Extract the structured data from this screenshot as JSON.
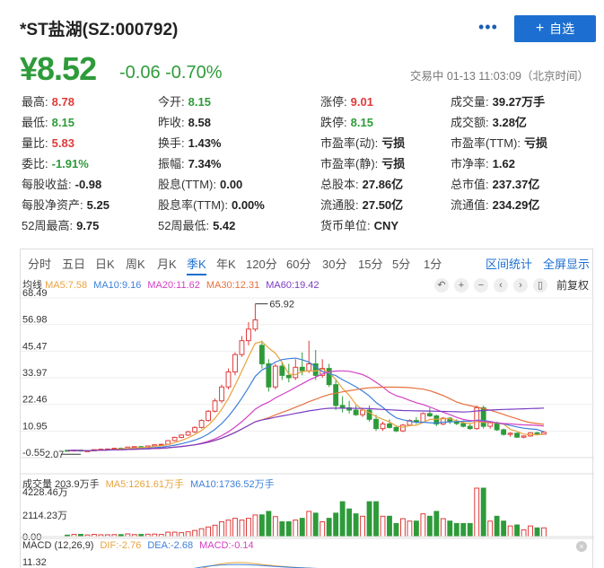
{
  "header": {
    "title": "*ST盐湖(SZ:000792)",
    "more": "•••",
    "add_label": "自选",
    "price": "¥8.52",
    "change": "-0.06 -0.70%",
    "status": "交易中 01-13 11:03:09（北京时间）"
  },
  "stats": [
    [
      {
        "label": "最高:",
        "value": "8.78",
        "tone": "up"
      },
      {
        "label": "今开:",
        "value": "8.15",
        "tone": "down"
      },
      {
        "label": "涨停:",
        "value": "9.01",
        "tone": "up"
      },
      {
        "label": "成交量:",
        "value": "39.27万手",
        "tone": ""
      }
    ],
    [
      {
        "label": "最低:",
        "value": "8.15",
        "tone": "down"
      },
      {
        "label": "昨收:",
        "value": "8.58",
        "tone": ""
      },
      {
        "label": "跌停:",
        "value": "8.15",
        "tone": "down"
      },
      {
        "label": "成交额:",
        "value": "3.28亿",
        "tone": ""
      }
    ],
    [
      {
        "label": "量比:",
        "value": "5.83",
        "tone": "up"
      },
      {
        "label": "换手:",
        "value": "1.43%",
        "tone": ""
      },
      {
        "label": "市盈率(动):",
        "value": "亏损",
        "tone": ""
      },
      {
        "label": "市盈率(TTM):",
        "value": "亏损",
        "tone": ""
      }
    ],
    [
      {
        "label": "委比:",
        "value": "-1.91%",
        "tone": "down"
      },
      {
        "label": "振幅:",
        "value": "7.34%",
        "tone": ""
      },
      {
        "label": "市盈率(静):",
        "value": "亏损",
        "tone": ""
      },
      {
        "label": "市净率:",
        "value": "1.62",
        "tone": ""
      }
    ],
    [
      {
        "label": "每股收益:",
        "value": "-0.98",
        "tone": ""
      },
      {
        "label": "股息(TTM):",
        "value": "0.00",
        "tone": ""
      },
      {
        "label": "总股本:",
        "value": "27.86亿",
        "tone": ""
      },
      {
        "label": "总市值:",
        "value": "237.37亿",
        "tone": ""
      }
    ],
    [
      {
        "label": "每股净资产:",
        "value": "5.25",
        "tone": ""
      },
      {
        "label": "股息率(TTM):",
        "value": "0.00%",
        "tone": ""
      },
      {
        "label": "流通股:",
        "value": "27.50亿",
        "tone": ""
      },
      {
        "label": "流通值:",
        "value": "234.29亿",
        "tone": ""
      }
    ],
    [
      {
        "label": "52周最高:",
        "value": "9.75",
        "tone": ""
      },
      {
        "label": "52周最低:",
        "value": "5.42",
        "tone": ""
      },
      {
        "label": "货币单位:",
        "value": "CNY",
        "tone": ""
      },
      {
        "label": "",
        "value": "",
        "tone": ""
      }
    ]
  ],
  "tabs": [
    "分时",
    "五日",
    "日K",
    "周K",
    "月K",
    "季K",
    "年K",
    "120分",
    "60分",
    "30分",
    "15分",
    "5分",
    "1分"
  ],
  "active_tab": "季K",
  "tab_actions": {
    "interval": "区间统计",
    "fullscreen": "全屏显示"
  },
  "ma_legend": {
    "label": "均线",
    "items": [
      {
        "text": "MA5:7.58",
        "color": "#e8a33d"
      },
      {
        "text": "MA10:9.16",
        "color": "#3d7fd9"
      },
      {
        "text": "MA20:11.62",
        "color": "#d43fc4"
      },
      {
        "text": "MA30:12.31",
        "color": "#e8703d"
      },
      {
        "text": "MA60:19.42",
        "color": "#7a3dc4"
      }
    ]
  },
  "restore_label": "前复权",
  "price_axis": [
    "68.49",
    "56.98",
    "45.47",
    "33.97",
    "22.46",
    "10.95",
    "-0.55"
  ],
  "annotations": {
    "high": "65.92",
    "low": "2.07"
  },
  "vol_legend": {
    "items": [
      {
        "text": "成交量 203.9万手",
        "color": "#333"
      },
      {
        "text": "MA5:1261.61万手",
        "color": "#e8a33d"
      },
      {
        "text": "MA10:1736.52万手",
        "color": "#3d7fd9"
      }
    ]
  },
  "vol_axis": [
    "4228.46万",
    "2114.23万",
    "0.00"
  ],
  "macd_legend": {
    "items": [
      {
        "text": "MACD (12,26,9)",
        "color": "#333"
      },
      {
        "text": "DIF:-2.76",
        "color": "#e8a33d"
      },
      {
        "text": "DEA:-2.68",
        "color": "#3d7fd9"
      },
      {
        "text": "MACD:-0.14",
        "color": "#d43fc4"
      }
    ]
  },
  "macd_axis": [
    "11.32"
  ],
  "colors": {
    "up": "#e03b3b",
    "down": "#2e9b3a",
    "accent": "#1c6fd0"
  },
  "chart_data": {
    "type": "candlestick",
    "ylim": [
      -0.55,
      68.49
    ],
    "candles": [
      [
        2.6,
        2.7,
        2.4,
        2.5
      ],
      [
        2.5,
        2.9,
        2.2,
        2.7
      ],
      [
        2.7,
        2.8,
        2.07,
        2.3
      ],
      [
        2.3,
        2.6,
        2.2,
        2.4
      ],
      [
        2.4,
        3.0,
        2.3,
        2.9
      ],
      [
        2.9,
        3.3,
        2.8,
        3.1
      ],
      [
        3.1,
        3.4,
        2.9,
        3.2
      ],
      [
        3.2,
        3.6,
        3.0,
        3.5
      ],
      [
        3.5,
        3.8,
        3.2,
        3.3
      ],
      [
        3.3,
        4.2,
        3.2,
        4.0
      ],
      [
        4.0,
        4.3,
        3.7,
        4.2
      ],
      [
        4.2,
        4.5,
        3.8,
        3.9
      ],
      [
        3.9,
        4.6,
        3.8,
        4.5
      ],
      [
        4.5,
        5.2,
        4.3,
        5.0
      ],
      [
        5.0,
        5.4,
        4.7,
        5.2
      ],
      [
        5.2,
        7.0,
        5.0,
        6.8
      ],
      [
        6.8,
        8.5,
        6.5,
        8.2
      ],
      [
        8.2,
        9.5,
        7.8,
        9.2
      ],
      [
        9.2,
        11.0,
        8.8,
        10.6
      ],
      [
        10.6,
        13.0,
        10.0,
        12.5
      ],
      [
        12.5,
        16.0,
        12.0,
        15.5
      ],
      [
        15.5,
        20.0,
        15.0,
        19.5
      ],
      [
        19.5,
        25.0,
        19.0,
        24.0
      ],
      [
        24.0,
        31.0,
        23.0,
        30.0
      ],
      [
        30.0,
        38.0,
        29.0,
        36.5
      ],
      [
        36.5,
        45.0,
        35.0,
        44.0
      ],
      [
        44.0,
        52.0,
        43.0,
        50.0
      ],
      [
        50.0,
        58.0,
        48.0,
        55.0
      ],
      [
        55.0,
        65.92,
        54.0,
        59.0
      ],
      [
        48.0,
        50.0,
        38.0,
        40.0
      ],
      [
        40.0,
        42.0,
        28.0,
        30.0
      ],
      [
        30.0,
        40.0,
        29.0,
        39.0
      ],
      [
        39.0,
        41.0,
        33.0,
        35.0
      ],
      [
        35.0,
        40.0,
        32.0,
        34.0
      ],
      [
        34.0,
        42.0,
        33.0,
        38.5
      ],
      [
        38.5,
        45.0,
        35.0,
        37.0
      ],
      [
        37.0,
        50.0,
        36.0,
        40.0
      ],
      [
        40.0,
        46.0,
        33.0,
        35.0
      ],
      [
        35.0,
        42.0,
        34.0,
        38.0
      ],
      [
        38.0,
        40.0,
        30.0,
        31.0
      ],
      [
        31.0,
        33.0,
        20.0,
        22.0
      ],
      [
        22.0,
        26.0,
        19.0,
        21.0
      ],
      [
        21.0,
        24.0,
        18.5,
        20.0
      ],
      [
        20.0,
        22.0,
        17.5,
        18.0
      ],
      [
        18.0,
        21.0,
        17.0,
        20.0
      ],
      [
        20.0,
        22.0,
        15.0,
        16.0
      ],
      [
        16.0,
        18.0,
        11.0,
        12.0
      ],
      [
        12.0,
        15.0,
        11.0,
        14.0
      ],
      [
        14.0,
        16.0,
        12.0,
        12.5
      ],
      [
        12.5,
        13.0,
        10.5,
        11.0
      ],
      [
        11.0,
        14.0,
        10.5,
        13.5
      ],
      [
        13.5,
        16.0,
        13.0,
        15.5
      ],
      [
        15.5,
        17.0,
        14.0,
        14.8
      ],
      [
        14.8,
        19.0,
        14.5,
        18.5
      ],
      [
        18.5,
        21.0,
        17.0,
        17.5
      ],
      [
        17.5,
        18.0,
        13.0,
        14.0
      ],
      [
        14.0,
        17.0,
        13.5,
        16.5
      ],
      [
        16.5,
        17.0,
        14.0,
        15.0
      ],
      [
        15.0,
        16.0,
        13.5,
        14.2
      ],
      [
        14.2,
        15.0,
        12.5,
        13.0
      ],
      [
        13.0,
        14.0,
        11.5,
        12.0
      ],
      [
        12.0,
        22.0,
        11.5,
        21.0
      ],
      [
        21.0,
        22.0,
        12.0,
        13.0
      ],
      [
        13.0,
        15.0,
        12.0,
        14.5
      ],
      [
        14.5,
        15.0,
        11.0,
        11.5
      ],
      [
        11.5,
        12.0,
        9.0,
        9.5
      ],
      [
        9.5,
        10.5,
        8.5,
        10.0
      ],
      [
        10.0,
        10.2,
        8.0,
        8.3
      ],
      [
        8.3,
        9.0,
        7.8,
        8.8
      ],
      [
        8.8,
        10.5,
        8.5,
        10.2
      ],
      [
        10.2,
        10.6,
        9.0,
        9.6
      ],
      [
        9.6,
        11.0,
        9.4,
        10.4
      ]
    ]
  }
}
